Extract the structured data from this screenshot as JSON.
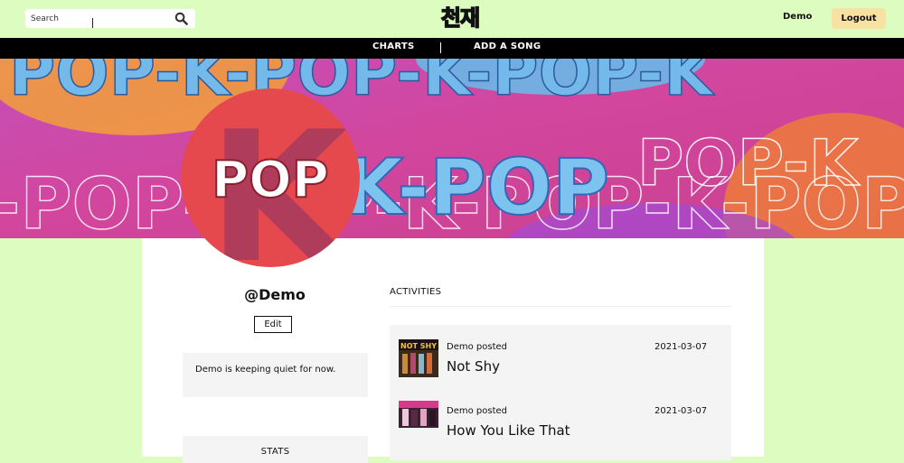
{
  "header": {
    "search_placeholder": "Search",
    "logo_text": "천재",
    "user_link": "Demo",
    "logout_label": "Logout"
  },
  "nav": {
    "items": [
      {
        "label": "CHARTS"
      },
      {
        "label": "ADD A SONG"
      }
    ]
  },
  "banner": {
    "word": "K-POP",
    "avatar_word": "POP",
    "avatar_letter": "K"
  },
  "profile": {
    "username": "@Demo",
    "edit_label": "Edit",
    "bio": "Demo is keeping quiet for now.",
    "stats_title": "STATS"
  },
  "activities": {
    "title": "ACTIVITIES",
    "items": [
      {
        "meta": "Demo posted",
        "date": "2021-03-07",
        "song": "Not Shy",
        "thumb_text": "NOT SHY"
      },
      {
        "meta": "Demo posted",
        "date": "2021-03-07",
        "song": "How You Like That"
      }
    ]
  },
  "colors": {
    "page_background": "#dcfcc0",
    "navbar": "#000000",
    "logout_button": "#f7e2a4",
    "avatar_red": "#e5484d",
    "panel_gray": "#f4f4f4"
  }
}
